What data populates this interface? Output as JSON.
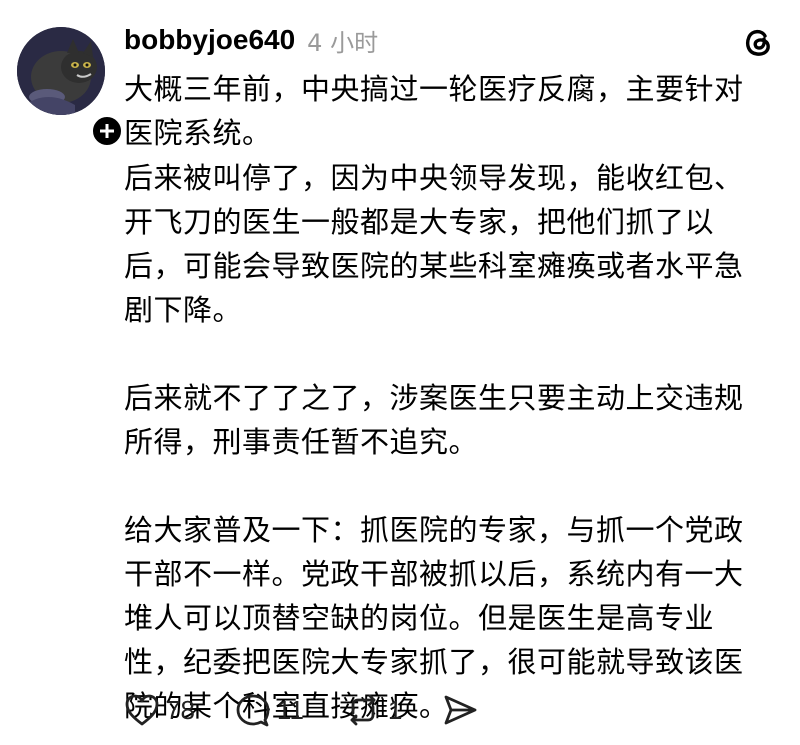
{
  "post": {
    "username": "bobbyjoe640",
    "timestamp": "4 小时",
    "paragraphs": [
      "大概三年前，中央搞过一轮医疗反腐，主要针对\n医院系统。",
      "后来被叫停了，因为中央领导发现，能收红包、\n开飞刀的医生一般都是大专家，把他们抓了以\n后，可能会导致医院的某些科室瘫痪或者水平急\n剧下降。",
      "后来就不了了之了，涉案医生只要主动上交违规\n所得，刑事责任暂不追究。",
      "给大家普及一下：抓医院的专家，与抓一个党政\n干部不一样。党政干部被抓以后，系统内有一大\n堆人可以顶替空缺的岗位。但是医生是高专业\n性，纪委把医院大专家抓了，很可能就导致该医\n院的某个科室直接瘫痪。"
    ],
    "actions": {
      "like_count": "78",
      "reply_count": "11",
      "repost_count": "1"
    }
  },
  "icons": {
    "avatar": "cartoon-cat-avatar",
    "follow": "plus-icon",
    "brand": "threads-logo-icon",
    "like": "heart-icon",
    "reply": "comment-bubble-icon",
    "repost": "repost-arrows-icon",
    "share": "send-icon"
  },
  "colors": {
    "text": "#000000",
    "muted": "#9a9a9a",
    "badge": "#000000"
  }
}
